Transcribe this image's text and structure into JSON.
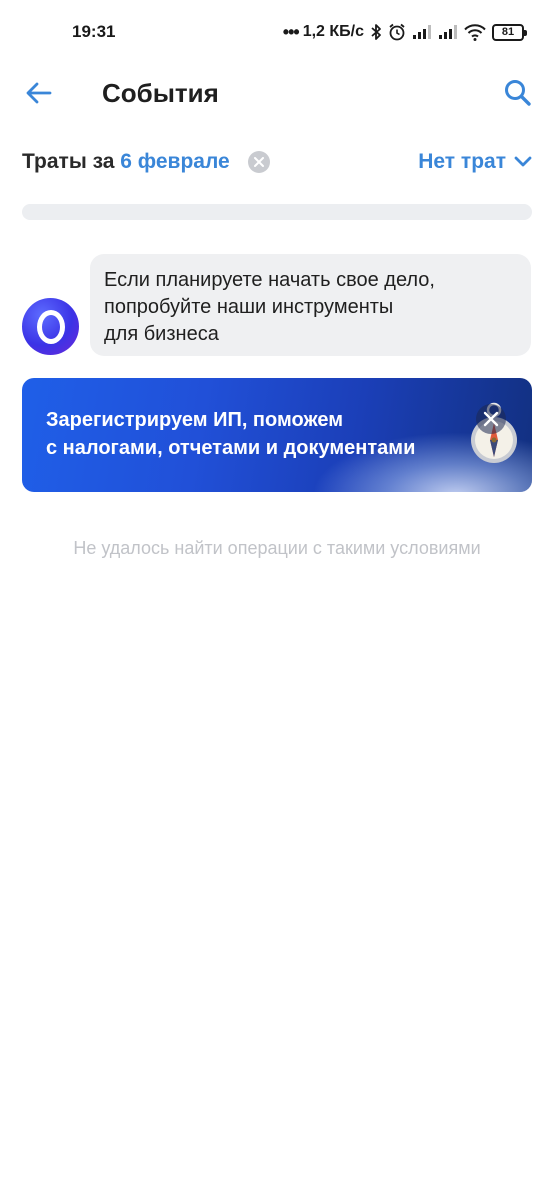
{
  "status_bar": {
    "time": "19:31",
    "dots": "•••",
    "speed": "1,2 КБ/с",
    "battery": "81",
    "icons": [
      "bluetooth-icon",
      "alarm-icon",
      "signal-icon",
      "signal-icon",
      "wifi-icon",
      "battery-icon"
    ]
  },
  "app_bar": {
    "title": "События",
    "back_icon": "arrow-left-icon",
    "search_icon": "search-icon",
    "accent_color": "#3a86d8"
  },
  "filter": {
    "prefix": "Траты за ",
    "date": "6 феврале",
    "type": "Нет трат"
  },
  "chat": {
    "lines": [
      "Если планируете начать свое дело,",
      "попробуйте наши инструменты",
      "для бизнеса"
    ]
  },
  "banner": {
    "lines": [
      "Зарегистрируем ИП, поможем",
      "с налогами, отчетами и документами"
    ],
    "color": "#1f5fe8"
  },
  "empty_message": "Не удалось найти операции с такими условиями"
}
